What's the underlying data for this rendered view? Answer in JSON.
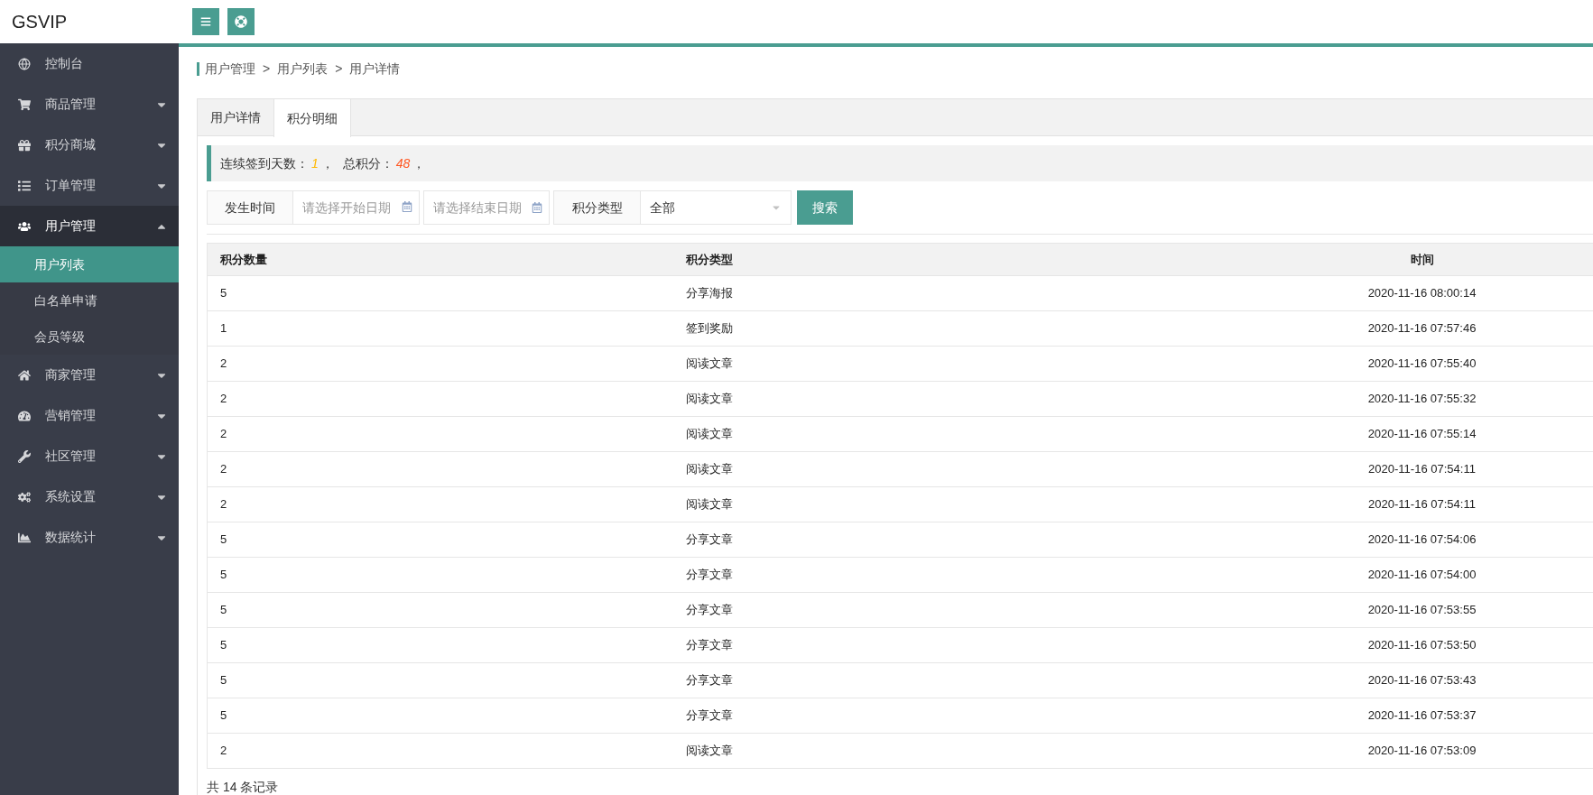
{
  "header": {
    "logo": "GSVIP"
  },
  "sidebar": {
    "items": [
      {
        "label": "控制台",
        "kind": "link"
      },
      {
        "label": "商品管理",
        "kind": "menu",
        "expanded": false
      },
      {
        "label": "积分商城",
        "kind": "menu",
        "expanded": false
      },
      {
        "label": "订单管理",
        "kind": "menu",
        "expanded": false
      },
      {
        "label": "用户管理",
        "kind": "menu",
        "expanded": true,
        "children": [
          {
            "label": "用户列表",
            "selected": true
          },
          {
            "label": "白名单申请",
            "selected": false
          },
          {
            "label": "会员等级",
            "selected": false
          }
        ]
      },
      {
        "label": "商家管理",
        "kind": "menu",
        "expanded": false
      },
      {
        "label": "营销管理",
        "kind": "menu",
        "expanded": false
      },
      {
        "label": "社区管理",
        "kind": "menu",
        "expanded": false
      },
      {
        "label": "系统设置",
        "kind": "menu",
        "expanded": false
      },
      {
        "label": "数据统计",
        "kind": "menu",
        "expanded": false
      }
    ]
  },
  "breadcrumb": [
    "用户管理",
    "用户列表",
    "用户详情"
  ],
  "breadcrumb_separator": ">",
  "tabs": [
    {
      "label": "用户详情",
      "selected": false
    },
    {
      "label": "积分明细",
      "selected": true
    }
  ],
  "summary": [
    {
      "label": "连续签到天数：",
      "value": "1",
      "after": "，",
      "color": "#ffb800"
    },
    {
      "label": "总积分：",
      "value": "48",
      "after": "，",
      "color": "#ff5722"
    }
  ],
  "filters": {
    "date_label": "发生时间",
    "start_placeholder": "请选择开始日期",
    "end_placeholder": "请选择结束日期",
    "type_label": "积分类型",
    "type_value": "全部",
    "search_button": "搜索"
  },
  "table": {
    "columns": [
      "积分数量",
      "积分类型",
      "时间"
    ],
    "rows": [
      [
        "5",
        "分享海报",
        "2020-11-16 08:00:14"
      ],
      [
        "1",
        "签到奖励",
        "2020-11-16 07:57:46"
      ],
      [
        "2",
        "阅读文章",
        "2020-11-16 07:55:40"
      ],
      [
        "2",
        "阅读文章",
        "2020-11-16 07:55:32"
      ],
      [
        "2",
        "阅读文章",
        "2020-11-16 07:55:14"
      ],
      [
        "2",
        "阅读文章",
        "2020-11-16 07:54:11"
      ],
      [
        "2",
        "阅读文章",
        "2020-11-16 07:54:11"
      ],
      [
        "5",
        "分享文章",
        "2020-11-16 07:54:06"
      ],
      [
        "5",
        "分享文章",
        "2020-11-16 07:54:00"
      ],
      [
        "5",
        "分享文章",
        "2020-11-16 07:53:55"
      ],
      [
        "5",
        "分享文章",
        "2020-11-16 07:53:50"
      ],
      [
        "5",
        "分享文章",
        "2020-11-16 07:53:43"
      ],
      [
        "5",
        "分享文章",
        "2020-11-16 07:53:37"
      ],
      [
        "2",
        "阅读文章",
        "2020-11-16 07:53:09"
      ]
    ]
  },
  "footer": "共 14 条记录"
}
